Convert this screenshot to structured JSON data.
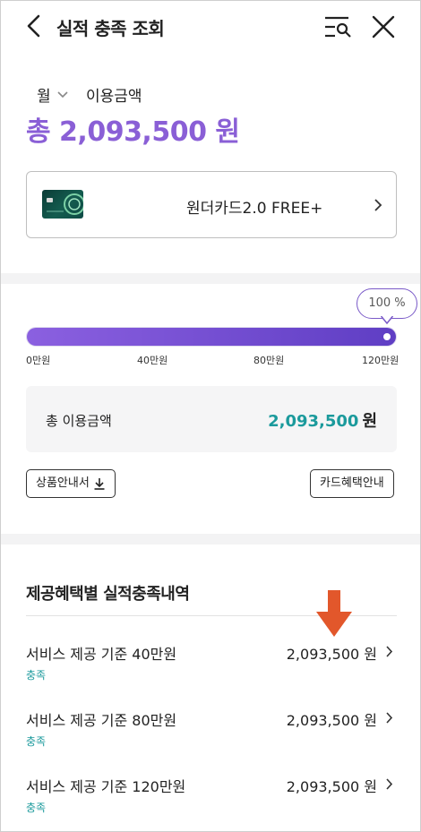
{
  "header": {
    "title": "실적 충족 조회",
    "back_icon": "chevron-left-icon",
    "filter_icon": "search-list-icon",
    "close_icon": "close-icon"
  },
  "summary": {
    "period": "월",
    "usage_label": "이용금액",
    "total": "총 2,093,500 원",
    "accent_color": "#8a5fd6"
  },
  "card": {
    "name": "원더카드2.0 FREE+"
  },
  "progress": {
    "percent_label": "100 %",
    "fill_fraction": 1.0,
    "ticks": [
      "0만원",
      "40만원",
      "80만원",
      "120만원"
    ]
  },
  "usage_box": {
    "label": "총 이용금액",
    "value": "2,093,500",
    "unit": "원",
    "value_color": "#1b9a9c"
  },
  "buttons": {
    "product_guide": "상품안내서",
    "card_benefits": "카드혜택안내"
  },
  "benefits": {
    "title": "제공혜택별 실적충족내역",
    "rows": [
      {
        "label": "서비스 제공 기준 40만원",
        "status": "충족",
        "amount": "2,093,500 원"
      },
      {
        "label": "서비스 제공 기준 80만원",
        "status": "충족",
        "amount": "2,093,500 원"
      },
      {
        "label": "서비스 제공 기준 120만원",
        "status": "충족",
        "amount": "2,093,500 원"
      }
    ]
  }
}
